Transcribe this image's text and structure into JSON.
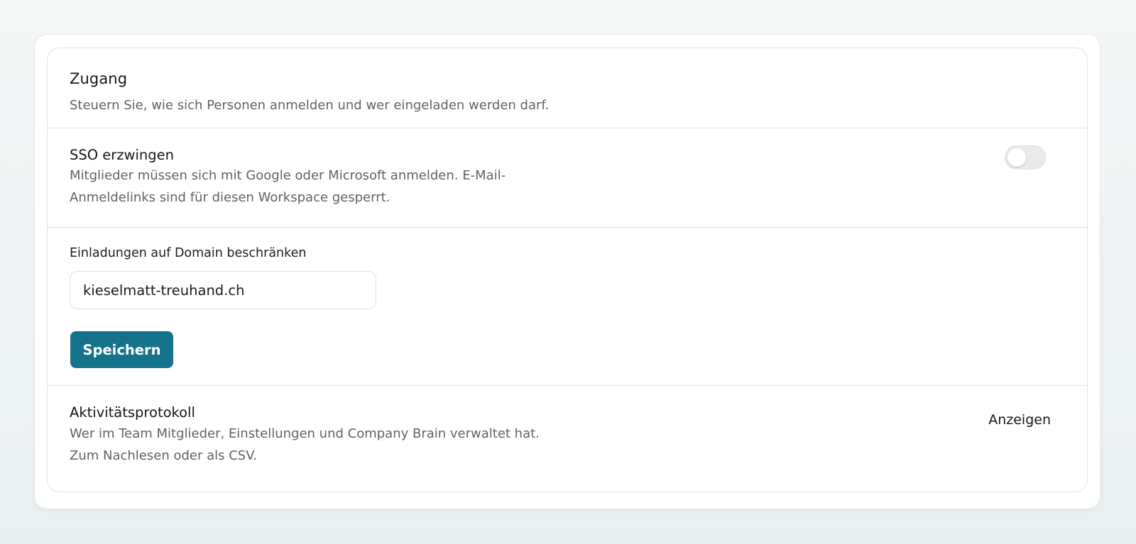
{
  "access": {
    "title": "Zugang",
    "subtitle": "Steuern Sie, wie sich Personen anmelden und wer eingeladen werden darf."
  },
  "sso": {
    "title": "SSO erzwingen",
    "description_line1": "Mitglieder müssen sich mit Google oder Microsoft anmelden. E-Mail-",
    "description_line2": "Anmeldelinks sind für diesen Workspace gesperrt.",
    "enabled": false
  },
  "domain_restriction": {
    "label": "Einladungen auf Domain beschränken",
    "value": "kieselmatt-treuhand.ch",
    "save_label": "Speichern",
    "button_color": "#14738a"
  },
  "activity_log": {
    "title": "Aktivitätsprotokoll",
    "description_line1": "Wer im Team Mitglieder, Einstellungen und Company Brain verwaltet hat.",
    "description_line2": "Zum Nachlesen oder als CSV.",
    "view_label": "Anzeigen"
  }
}
